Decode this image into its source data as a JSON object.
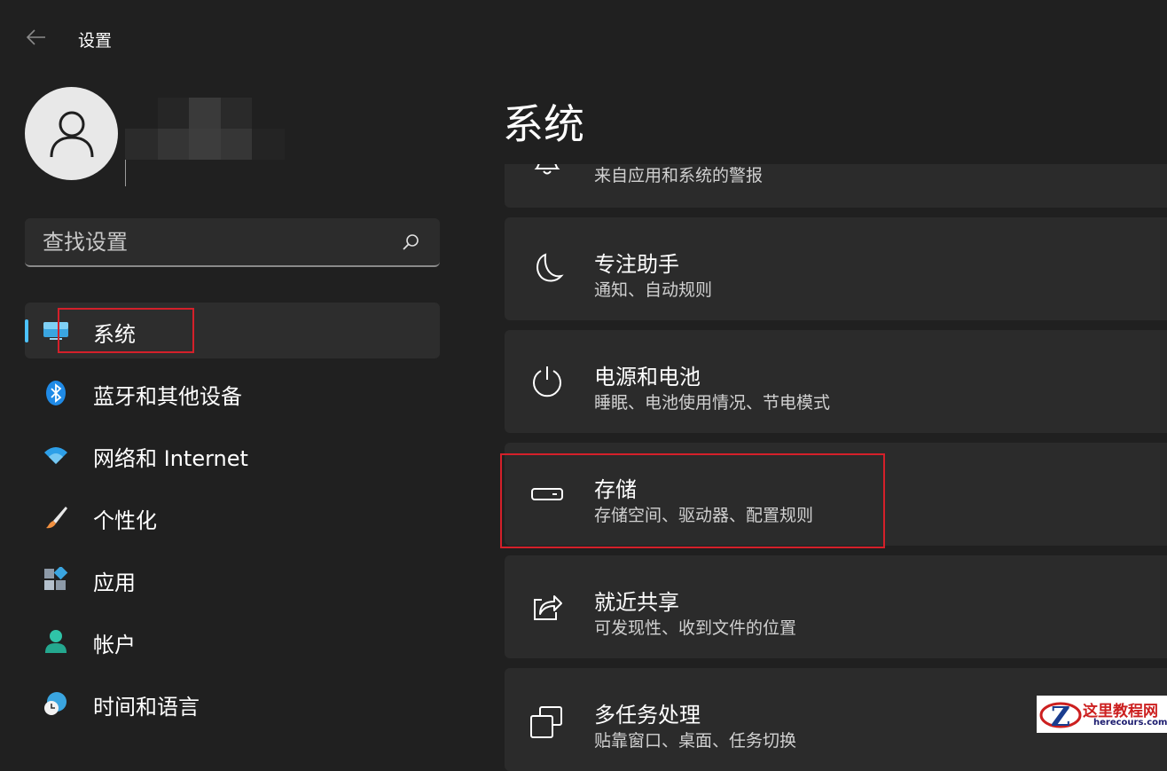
{
  "window": {
    "title": "设置"
  },
  "search": {
    "placeholder": "查找设置"
  },
  "nav": {
    "items": [
      {
        "label": "系统"
      },
      {
        "label": "蓝牙和其他设备"
      },
      {
        "label": "网络和 Internet"
      },
      {
        "label": "个性化"
      },
      {
        "label": "应用"
      },
      {
        "label": "帐户"
      },
      {
        "label": "时间和语言"
      }
    ],
    "accent_color": "#4cc2ff"
  },
  "main": {
    "title": "系统",
    "cards": [
      {
        "title": "",
        "subtitle": "来自应用和系统的警报",
        "icon": "bell-icon"
      },
      {
        "title": "专注助手",
        "subtitle": "通知、自动规则",
        "icon": "moon-icon"
      },
      {
        "title": "电源和电池",
        "subtitle": "睡眠、电池使用情况、节电模式",
        "icon": "power-icon"
      },
      {
        "title": "存储",
        "subtitle": "存储空间、驱动器、配置规则",
        "icon": "storage-drive-icon"
      },
      {
        "title": "就近共享",
        "subtitle": "可发现性、收到文件的位置",
        "icon": "share-icon"
      },
      {
        "title": "多任务处理",
        "subtitle": "贴靠窗口、桌面、任务切换",
        "icon": "multitasking-icon"
      }
    ]
  },
  "highlight_color": "#d4202a",
  "watermark": {
    "text": "这里教程网",
    "domain": "herecours.com"
  }
}
